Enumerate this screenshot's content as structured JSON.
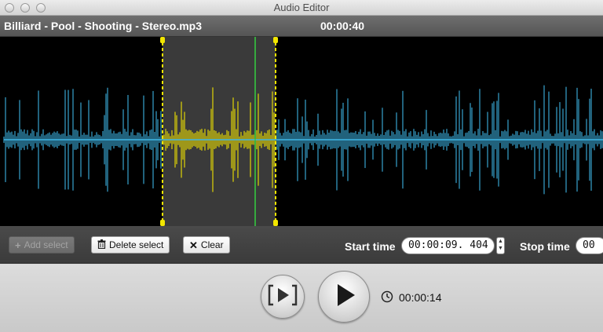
{
  "window": {
    "title": "Audio Editor"
  },
  "file": {
    "name": "Billiard - Pool - Shooting - Stereo.mp3",
    "duration": "00:00:40"
  },
  "selection_controls": {
    "add_select_label": "Add select",
    "delete_select_label": "Delete select",
    "clear_label": "Clear",
    "start_time_label": "Start time",
    "start_time_value": "00:00:09. 404",
    "stop_time_label": "Stop time",
    "stop_time_value": "00"
  },
  "playback": {
    "current_time": "00:00:14"
  },
  "colors": {
    "waveform_unselected": "#3fb6e6",
    "waveform_selected": "#f2e600",
    "selection_edge": "#f2e600",
    "playhead": "#35d040",
    "selection_overlay": "#3a3a3a"
  },
  "icons": {
    "add": "plus-icon",
    "delete": "trash-icon",
    "clear": "x-icon",
    "play_selection": "play-selection-icon",
    "play": "play-icon",
    "clock": "clock-icon"
  }
}
